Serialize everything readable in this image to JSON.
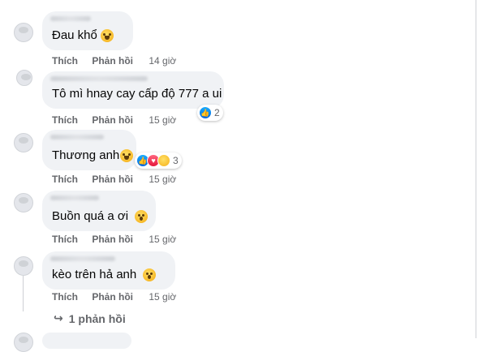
{
  "actions": {
    "like": "Thích",
    "reply": "Phản hồi"
  },
  "comments": [
    {
      "text": "Đau khổ",
      "emoji": "laughing-emoji",
      "time": "14 giờ"
    },
    {
      "text": "Tô mì hnay cay cấp độ 777 a ui",
      "time": "15 giờ",
      "reactions": [
        "like-icon"
      ],
      "reaction_count": "2"
    },
    {
      "text": "Thương anh",
      "emoji": "rofl-emoji",
      "time": "15 giờ",
      "reactions": [
        "like-icon",
        "love-icon",
        "haha-icon"
      ],
      "reaction_count": "3"
    },
    {
      "text": "Buồn quá a ơi",
      "emoji": "wow-emoji",
      "time": "15 giờ"
    },
    {
      "text": "kèo trên hả anh",
      "emoji": "scream-emoji",
      "time": "15 giờ"
    }
  ],
  "view_replies": "1 phản hồi",
  "colors": {
    "bubble": "#f0f2f5",
    "meta": "#65676b",
    "like_blue": "#0866ff"
  }
}
